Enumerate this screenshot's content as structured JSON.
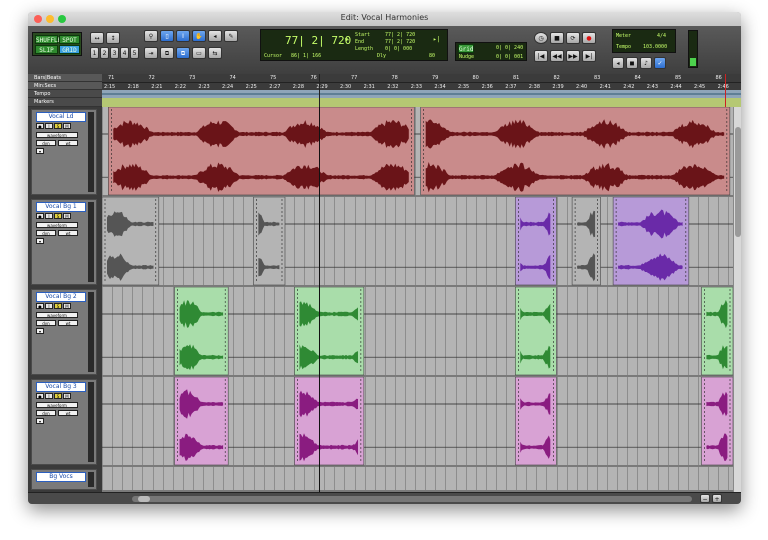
{
  "window": {
    "title": "Edit: Vocal Harmonies"
  },
  "colors": {
    "close": "#fc5f57",
    "minimize": "#fdbc2e",
    "zoom": "#28c840",
    "lead_clip": "#c98b8b",
    "lead_wave": "#6a1418",
    "bg1_clip": "#b4b4b4",
    "bg1_wave": "#555555",
    "bg1_alt_clip": "#b79ad8",
    "bg1_alt_wave": "#6a2aa8",
    "bg2_clip": "#a9ddaa",
    "bg2_wave": "#2f8a34",
    "bg3_clip": "#d8a2d4",
    "bg3_wave": "#8a1c80"
  },
  "toolbar": {
    "mode_shuffle": "SHUFFLE",
    "mode_spot": "SPOT",
    "mode_slip": "SLIP",
    "mode_grid": "GRID",
    "main_counter": "77| 2| 720",
    "start_label": "Start",
    "start_value": "77| 2| 720",
    "end_label": "End",
    "end_value": "77| 2| 720",
    "length_label": "Length",
    "length_value": "0| 0| 000",
    "cursor_label": "Cursor",
    "cursor_value": "86| 1| 166",
    "grid_label": "Grid",
    "grid_value": "0| 0| 240",
    "nudge_label": "Nudge",
    "nudge_value": "0| 0| 001",
    "dly_label": "Dly",
    "dly_value": "80",
    "tempo_label": "Tempo",
    "tempo_value": "103.0000",
    "meter_label": "Meter",
    "meter_value": "4/4"
  },
  "rulers": {
    "bars_label": "Bars|Beats",
    "min_label": "Min:Secs",
    "tempo_label": "Tempo",
    "markers_label": "Markers",
    "bar_ticks": [
      "71",
      "72",
      "73",
      "74",
      "75",
      "76",
      "77",
      "78",
      "79",
      "80",
      "81",
      "82",
      "83",
      "84",
      "85",
      "86"
    ],
    "min_ticks": [
      "2:15",
      "2:18",
      "2:21",
      "2:22",
      "2:23",
      "2:24",
      "2:25",
      "2:27",
      "2:28",
      "2:29",
      "2:30",
      "2:31",
      "2:32",
      "2:33",
      "2:34",
      "2:35",
      "2:36",
      "2:37",
      "2:38",
      "2:39",
      "2:40",
      "2:41",
      "2:42",
      "2:43",
      "2:44",
      "2:45",
      "2:46"
    ]
  },
  "tracks": [
    {
      "name": "Vocal Ld",
      "waveform": "waveform",
      "view": "dyn",
      "mode": "wt"
    },
    {
      "name": "Vocal Bg 1",
      "waveform": "waveform",
      "view": "dyn",
      "mode": "wt"
    },
    {
      "name": "Vocal Bg 2",
      "waveform": "waveform",
      "view": "dyn",
      "mode": "wt"
    },
    {
      "name": "Vocal Bg 3",
      "waveform": "waveform",
      "view": "dyn",
      "mode": "wt"
    },
    {
      "name": "Bg Vocs",
      "waveform": "waveform",
      "view": "dyn",
      "mode": "wt"
    }
  ],
  "clips": {
    "lead": [
      [
        0.01,
        0.495
      ],
      [
        0.505,
        0.995
      ]
    ],
    "bg1": [
      [
        0.0,
        0.09
      ],
      [
        0.24,
        0.29
      ],
      [
        0.655,
        0.72
      ],
      [
        0.745,
        0.79
      ],
      [
        0.81,
        0.93
      ]
    ],
    "bg1_purple": [
      2,
      4
    ],
    "bg2": [
      [
        0.115,
        0.2
      ],
      [
        0.305,
        0.415
      ],
      [
        0.655,
        0.72
      ],
      [
        0.95,
        1.0
      ]
    ],
    "bg3": [
      [
        0.115,
        0.2
      ],
      [
        0.305,
        0.415
      ],
      [
        0.655,
        0.72
      ],
      [
        0.95,
        1.0
      ]
    ]
  }
}
